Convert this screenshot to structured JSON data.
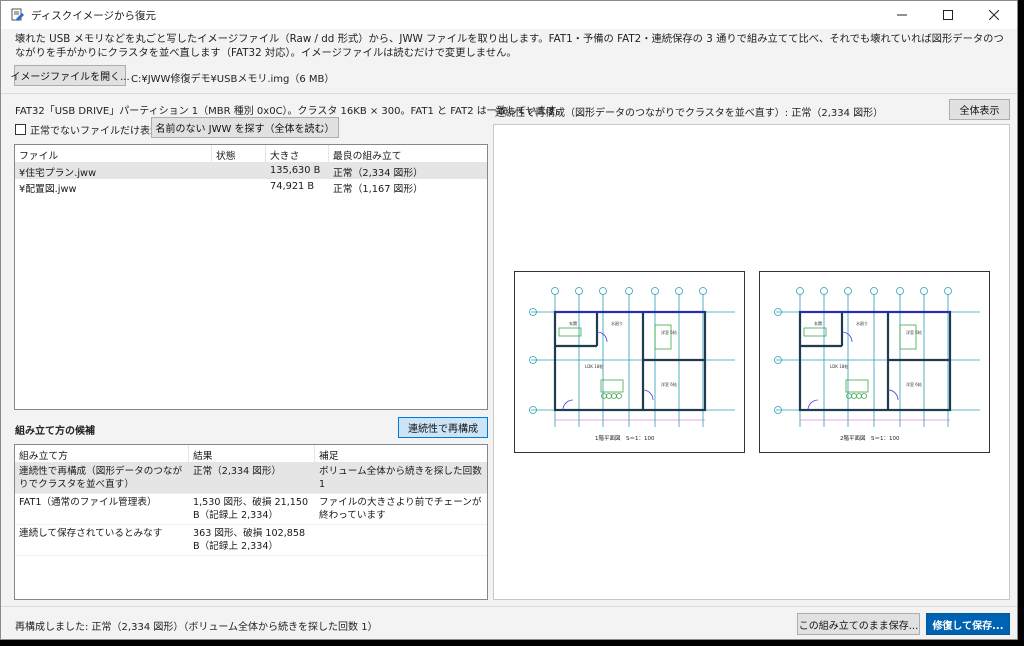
{
  "window": {
    "title": "ディスクイメージから復元"
  },
  "description": "壊れた USB メモリなどを丸ごと写したイメージファイル（Raw / dd 形式）から、JWW ファイルを取り出します。FAT1・予備の FAT2・連続保存の 3 通りで組み立てて比べ、それでも壊れていれば図形データのつながりを手がかりにクラスタを並べ直します（FAT32 対応）。イメージファイルは読むだけで変更しません。",
  "open_button": "イメージファイルを開く...",
  "image_path": "C:¥JWW修復デモ¥USBメモリ.img（6 MB）",
  "partition_info": "FAT32「USB DRIVE」パーティション 1（MBR 種別 0x0C）。クラスタ 16KB × 300。FAT1 と FAT2 は一致しています。",
  "abnormal_only_label": "正常でないファイルだけ表示",
  "find_unnamed_button": "名前のない JWW を探す（全体を読む）",
  "files": {
    "columns": [
      "ファイル",
      "状態",
      "大きさ",
      "最良の組み立て"
    ],
    "rows": [
      {
        "name": "¥住宅プラン.jww",
        "state": "",
        "size": "135,630 B",
        "best": "正常（2,334 図形）"
      },
      {
        "name": "¥配置図.jww",
        "state": "",
        "size": "74,921 B",
        "best": "正常（1,167 図形）"
      }
    ]
  },
  "candidates": {
    "title": "組み立て方の候補",
    "reconstruct_button": "連続性で再構成",
    "columns": [
      "組み立て方",
      "結果",
      "補足"
    ],
    "rows": [
      {
        "method": "連続性で再構成（図形データのつながりでクラスタを並べ直す）",
        "result": "正常（2,334 図形）",
        "note": "ボリューム全体から続きを探した回数 1"
      },
      {
        "method": "FAT1（通常のファイル管理表）",
        "result": "1,530 図形、破損 21,150 B（記録上 2,334）",
        "note": "ファイルの大きさより前でチェーンが終わっています"
      },
      {
        "method": "連続して保存されているとみなす",
        "result": "363 図形、破損 102,858 B（記録上 2,334）",
        "note": ""
      }
    ]
  },
  "preview": {
    "title": "連続性で再構成（図形データのつながりでクラスタを並べ直す）: 正常（2,334 図形）",
    "fit_button": "全体表示",
    "sheets": [
      {
        "caption": "1階平面図　S＝1：100",
        "rooms": [
          "玄関",
          "水廻り",
          "洋室 6帖",
          "LDK 18帖",
          "洋室 6帖"
        ]
      },
      {
        "caption": "2階平面図　S＝1：100",
        "rooms": [
          "玄関",
          "水廻り",
          "洋室 6帖",
          "LDK 18帖",
          "洋室 6帖"
        ]
      }
    ]
  },
  "status": "再構成しました: 正常（2,334 図形）（ボリューム全体から続きを探した回数 1）",
  "save_as_is_button": "この組み立てのまま保存...",
  "repair_save_button": "修復して保存..."
}
